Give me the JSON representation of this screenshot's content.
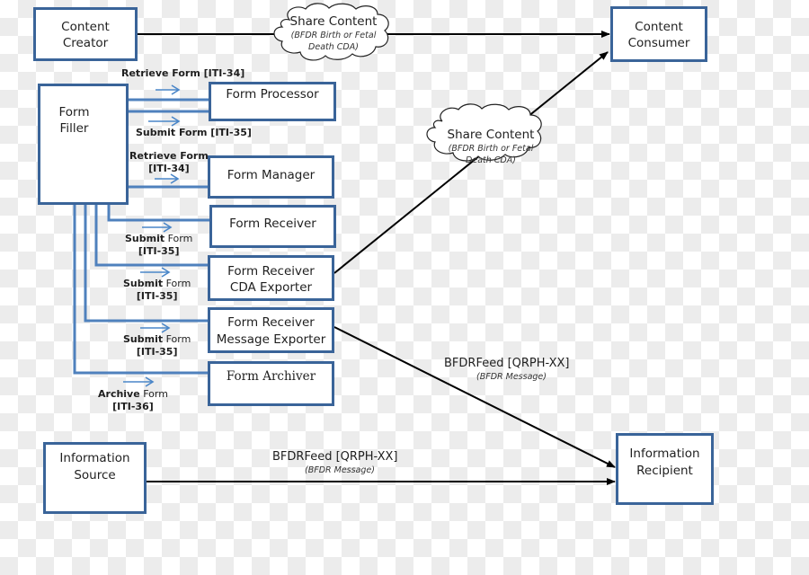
{
  "diagram": {
    "type": "actor-transaction diagram",
    "colors": {
      "box_border": "#3a6499",
      "connector": "#4f81bd",
      "direction_arrow": "#4a86c8",
      "flow_line": "#000000"
    }
  },
  "actors": {
    "content_creator": {
      "line1": "Content",
      "line2": "Creator"
    },
    "content_consumer": {
      "line1": "Content",
      "line2": "Consumer"
    },
    "form_filler": {
      "line1": "Form",
      "line2": "Filler"
    },
    "form_processor": {
      "line1": "Form Processor"
    },
    "form_manager": {
      "line1": "Form Manager"
    },
    "form_receiver": {
      "line1": "Form Receiver"
    },
    "form_receiver_cda_exporter": {
      "line1": "Form Receiver",
      "line2": "CDA Exporter"
    },
    "form_receiver_message_exporter": {
      "line1": "Form Receiver",
      "line2": "Message Exporter"
    },
    "form_archiver": {
      "line1": "Form Archiver"
    },
    "information_source": {
      "line1": "Information",
      "line2": "Source"
    },
    "information_recipient": {
      "line1": "Information",
      "line2": "Recipient"
    }
  },
  "transactions": {
    "retrieve_form_processor": {
      "bold": "Retrieve Form [ITI-34]"
    },
    "submit_form_processor": {
      "bold": "Submit Form [ITI-35]"
    },
    "retrieve_form_manager": {
      "bold": "Retrieve Form",
      "bold2": "[ITI-34]"
    },
    "submit_form_receiver": {
      "bold": "Submit",
      "normal": " Form",
      "bold2": "[ITI-35]"
    },
    "submit_form_cda_exporter": {
      "bold": "Submit",
      "normal": " Form",
      "bold2": "[ITI-35]"
    },
    "submit_form_message_exporter": {
      "bold": "Submit",
      "normal": " Form",
      "bold2": "[ITI-35]"
    },
    "archive_form": {
      "bold": "Archive",
      "normal": " Form",
      "bold2": "[ITI-36]"
    }
  },
  "clouds": {
    "top": {
      "title": "Share Content",
      "sub1": "(BFDR Birth or Fetal",
      "sub2": "Death CDA)"
    },
    "middle": {
      "title": "Share Content",
      "sub1": "(BFDR Birth or Fetal",
      "sub2": "Death CDA)"
    }
  },
  "messages": {
    "exporter_feed": {
      "title": "BFDRFeed [QRPH-XX]",
      "sub": "(BFDR Message)"
    },
    "source_feed": {
      "title": "BFDRFeed [QRPH-XX]",
      "sub": "(BFDR Message)"
    }
  }
}
